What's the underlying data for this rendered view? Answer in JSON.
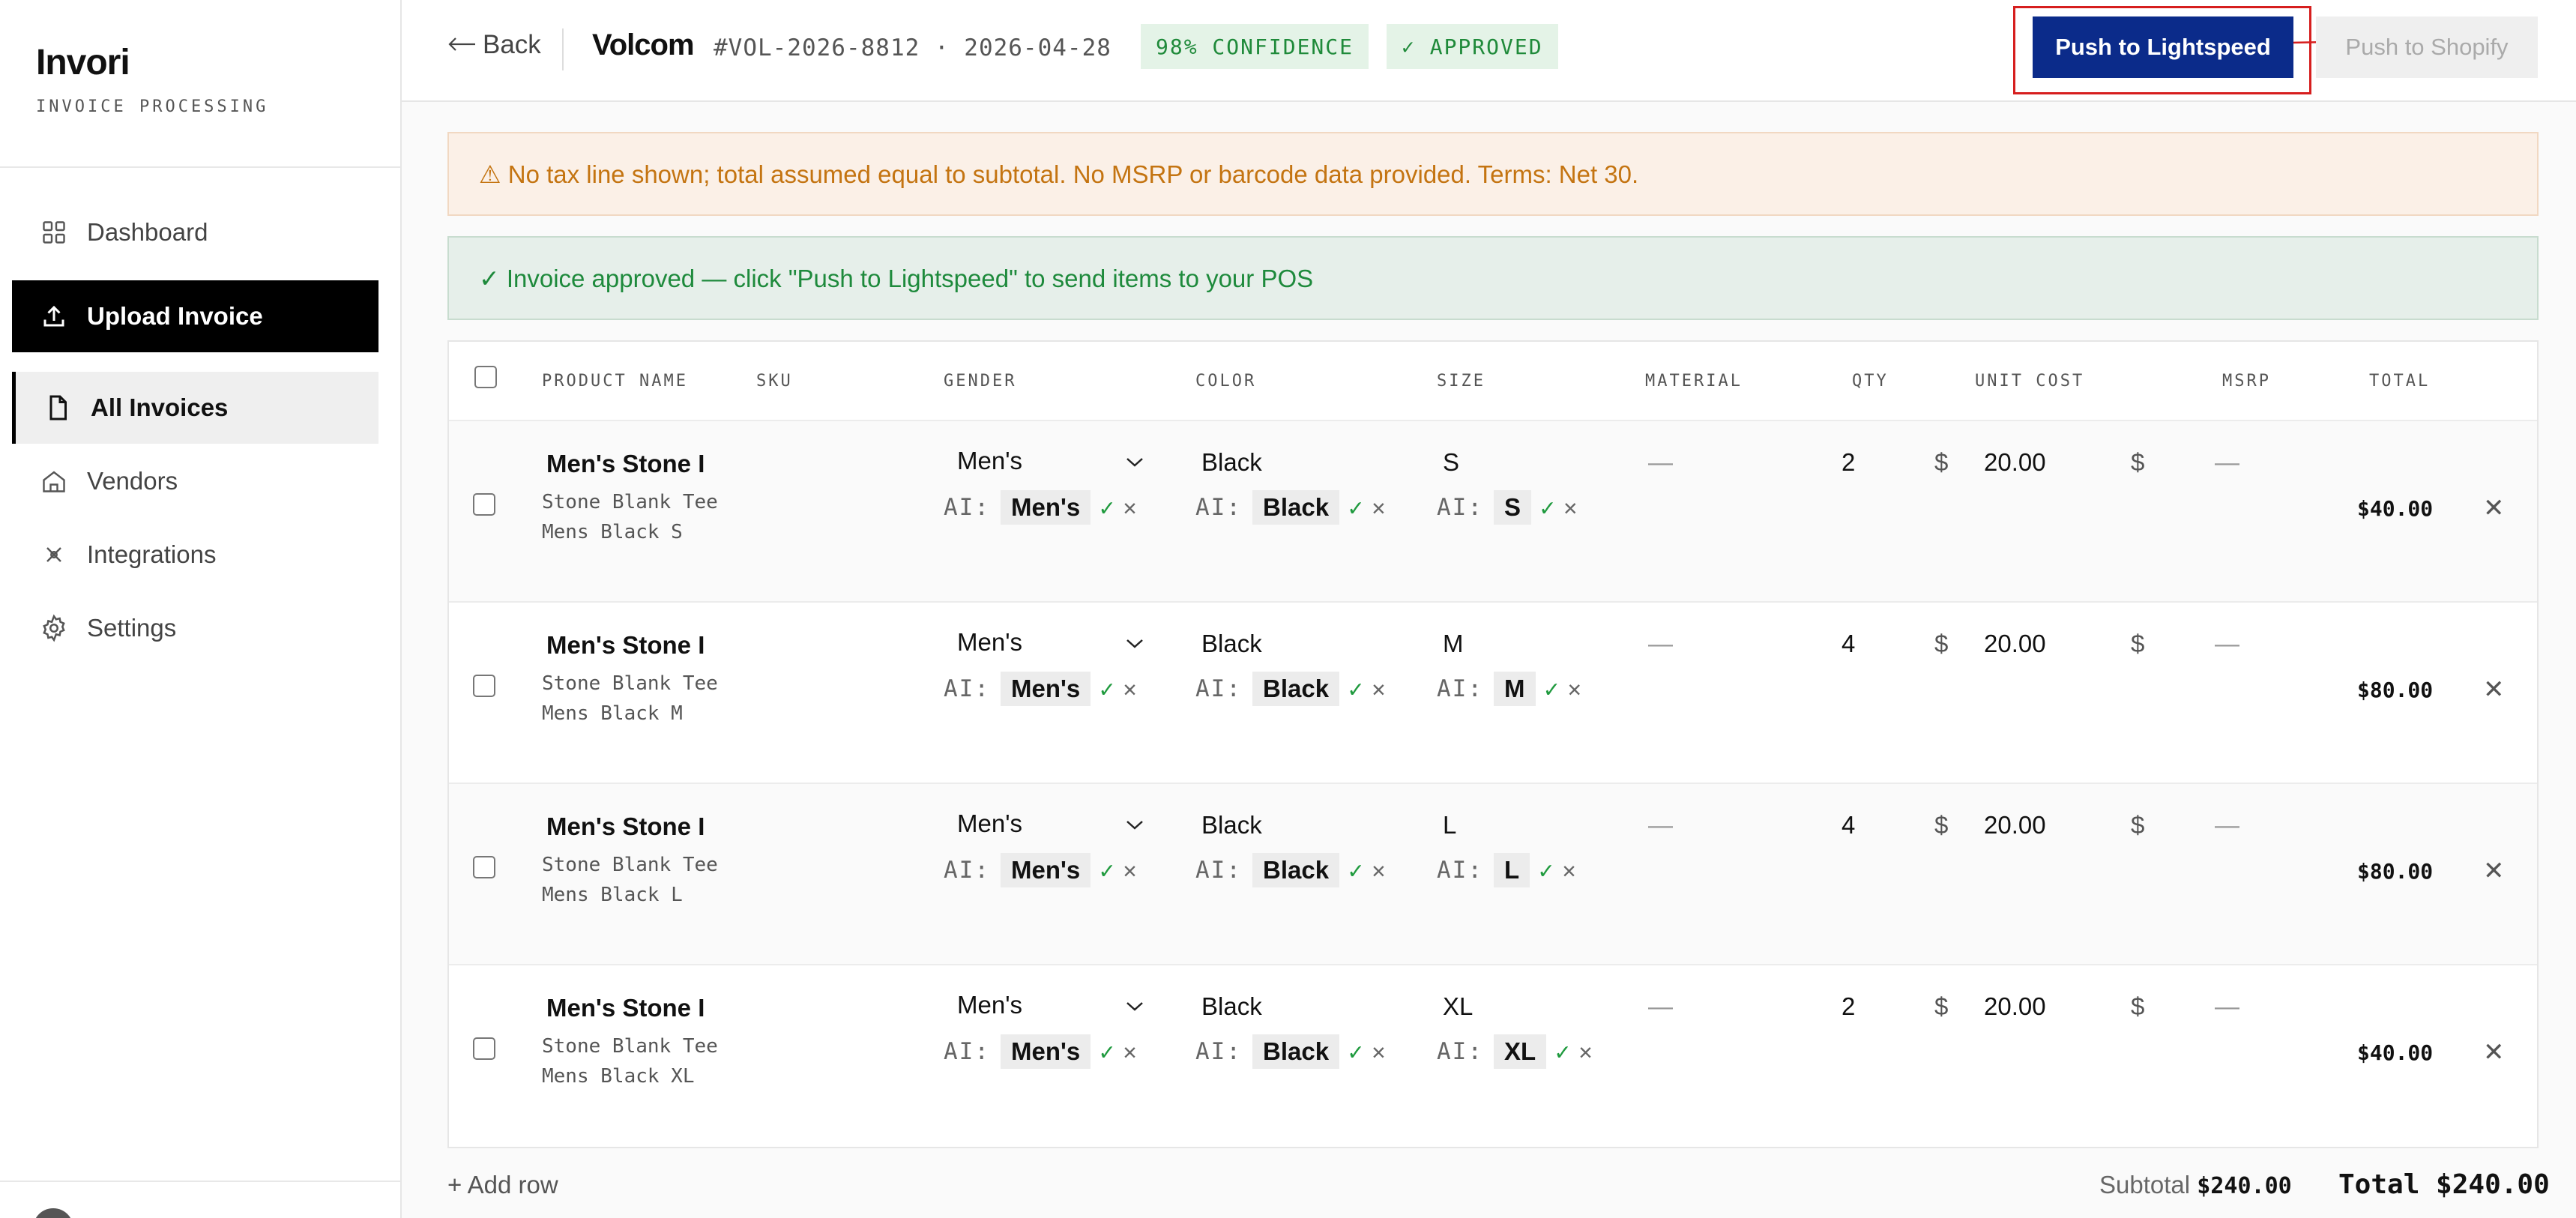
{
  "app": {
    "name": "Invori",
    "subtitle": "INVOICE PROCESSING"
  },
  "sidebar": {
    "items": [
      {
        "label": "Dashboard",
        "icon": "grid-icon"
      },
      {
        "label": "Upload Invoice",
        "icon": "upload-icon"
      },
      {
        "label": "All Invoices",
        "icon": "document-icon"
      },
      {
        "label": "Vendors",
        "icon": "home-icon"
      },
      {
        "label": "Integrations",
        "icon": "connect-icon"
      },
      {
        "label": "Settings",
        "icon": "gear-icon"
      }
    ]
  },
  "header": {
    "back_label": "Back",
    "vendor": "Volcom",
    "invoice_meta": "#VOL-2026-8812 · 2026-04-28",
    "confidence_badge": "98% CONFIDENCE",
    "status_badge": "✓ APPROVED",
    "push_lightspeed": "Push to Lightspeed",
    "push_shopify": "Push to Shopify"
  },
  "banners": {
    "warning": "⚠  No tax line shown; total assumed equal to subtotal. No MSRP or barcode data provided. Terms: Net 30.",
    "success": "✓ Invoice approved — click \"Push to Lightspeed\" to send items to your POS"
  },
  "table": {
    "headers": [
      "PRODUCT NAME",
      "SKU",
      "GENDER",
      "COLOR",
      "SIZE",
      "MATERIAL",
      "QTY",
      "UNIT COST",
      "MSRP",
      "TOTAL"
    ],
    "ai_label": "AI:",
    "rows": [
      {
        "name": "Men's Stone I",
        "desc": "Stone Blank Tee Mens Black S",
        "gender": "Men's",
        "ai_gender": "Men's",
        "color": "Black",
        "ai_color": "Black",
        "size": "S",
        "ai_size": "S",
        "material": "—",
        "qty": "2",
        "unit_cost": "20.00",
        "msrp": "—",
        "total": "$40.00"
      },
      {
        "name": "Men's Stone I",
        "desc": "Stone Blank Tee Mens Black M",
        "gender": "Men's",
        "ai_gender": "Men's",
        "color": "Black",
        "ai_color": "Black",
        "size": "M",
        "ai_size": "M",
        "material": "—",
        "qty": "4",
        "unit_cost": "20.00",
        "msrp": "—",
        "total": "$80.00"
      },
      {
        "name": "Men's Stone I",
        "desc": "Stone Blank Tee Mens Black L",
        "gender": "Men's",
        "ai_gender": "Men's",
        "color": "Black",
        "ai_color": "Black",
        "size": "L",
        "ai_size": "L",
        "material": "—",
        "qty": "4",
        "unit_cost": "20.00",
        "msrp": "—",
        "total": "$80.00"
      },
      {
        "name": "Men's Stone I",
        "desc": "Stone Blank Tee Mens Black XL",
        "gender": "Men's",
        "ai_gender": "Men's",
        "color": "Black",
        "ai_color": "Black",
        "size": "XL",
        "ai_size": "XL",
        "material": "—",
        "qty": "2",
        "unit_cost": "20.00",
        "msrp": "—",
        "total": "$40.00"
      }
    ]
  },
  "footer": {
    "add_row": "+ Add row",
    "subtotal_label": "Subtotal",
    "subtotal_value": "$240.00",
    "total_label": "Total $240.00"
  },
  "colors": {
    "primary": "#0b2b8a",
    "success": "#1f8a3a",
    "warning": "#c47411",
    "annotation": "#d61e1e"
  }
}
